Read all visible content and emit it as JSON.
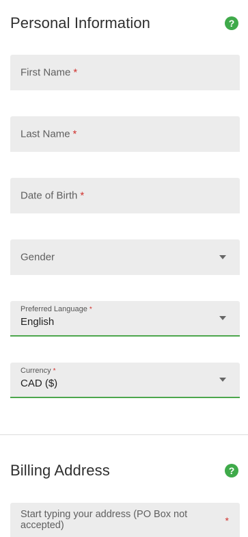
{
  "personal": {
    "title": "Personal Information",
    "help_icon": "question-mark-icon",
    "first_name": {
      "placeholder": "First Name",
      "required": "*"
    },
    "last_name": {
      "placeholder": "Last Name",
      "required": "*"
    },
    "dob": {
      "placeholder": "Date of Birth",
      "required": "*"
    },
    "gender": {
      "placeholder": "Gender"
    },
    "language": {
      "label": "Preferred Language",
      "required": "*",
      "value": "English"
    },
    "currency": {
      "label": "Currency",
      "required": "*",
      "value": "CAD ($)"
    }
  },
  "billing": {
    "title": "Billing Address",
    "help_icon": "question-mark-icon",
    "address": {
      "placeholder": "Start typing your address (PO Box not accepted)",
      "required": "*"
    }
  },
  "colors": {
    "accent_green": "#3faa4a",
    "required_red": "#d0302c",
    "field_bg": "#ececec"
  }
}
